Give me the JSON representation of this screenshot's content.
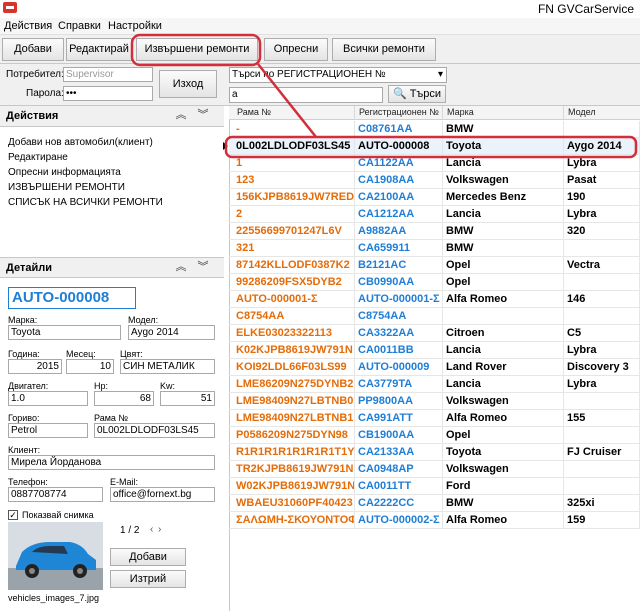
{
  "app": {
    "title": "FN GVCarService"
  },
  "menu": [
    "Действия",
    "Справки",
    "Настройки"
  ],
  "toolbar": {
    "add": "Добави",
    "edit": "Редактирай",
    "done_repairs": "Извършени ремонти",
    "ops": "Опресни",
    "all_repairs": "Всички ремонти"
  },
  "login": {
    "user_label": "Потребител:",
    "user_placeholder": "Supervisor",
    "pass_label": "Парола:",
    "pass_value": "•••",
    "login_button": "Изход"
  },
  "search": {
    "mode": "Търси по РЕГИСТРАЦИОНЕН №",
    "query": "a",
    "button": "Търси"
  },
  "actions": {
    "title": "Действия",
    "items": [
      "Добави нов автомобил(клиент)",
      "Редактиране",
      "Опресни информацията",
      "ИЗВЪРШЕНИ РЕМОНТИ",
      "СПИСЪК НА ВСИЧКИ РЕМОНТИ"
    ]
  },
  "details": {
    "title": "Детайли",
    "reg": "AUTO-000008",
    "make_label": "Марка:",
    "make": "Toyota",
    "model_label": "Модел:",
    "model": "Aygo 2014",
    "year_label": "Година:",
    "year": "2015",
    "month_label": "Месец:",
    "month": "10",
    "color_label": "Цвят:",
    "color": "СИН МЕТАЛИК",
    "engine_label": "Двигател:",
    "engine": "1.0",
    "hp_label": "Hp:",
    "hp": "68",
    "kw_label": "Kw:",
    "kw": "51",
    "fuel_label": "Гориво:",
    "fuel": "Petrol",
    "vin_label": "Рама №",
    "vin": "0L002LDLODF03LS45",
    "client_label": "Клиент:",
    "client": "Мирела Йорданова",
    "phone_label": "Телефон:",
    "phone": "0887708774",
    "email_label": "E-Mail:",
    "email": "office@fornext.bg",
    "show_image": "Показвай снимка",
    "image_counter": "1 / 2",
    "add_image": "Добави",
    "delete_image": "Изтрий",
    "image_name": "vehicles_images_7.jpg"
  },
  "grid": {
    "columns": [
      "Рама №",
      "Регистрационен №",
      "Марка",
      "Модел"
    ],
    "rows": [
      [
        "-",
        "C08761AA",
        "BMW",
        ""
      ],
      [
        "0L002LDLODF03LS45",
        "AUTO-000008",
        "Toyota",
        "Aygo 2014"
      ],
      [
        "1",
        "CA1122AA",
        "Lancia",
        "Lybra"
      ],
      [
        "123",
        "CA1908AA",
        "Volkswagen",
        "Pasat"
      ],
      [
        "156KJPB8619JW7RED",
        "CA2100AA",
        "Mercedes Benz",
        "190"
      ],
      [
        "2",
        "CA1212AA",
        "Lancia",
        "Lybra"
      ],
      [
        "22556699701247L6V",
        "A9882AA",
        "BMW",
        "320"
      ],
      [
        "321",
        "CA659911",
        "BMW",
        ""
      ],
      [
        "87142KLLODF0387K2",
        "B2121AC",
        "Opel",
        "Vectra"
      ],
      [
        "99286209FSX5DYB2",
        "CB0990AA",
        "Opel",
        ""
      ],
      [
        "AUTO-000001-Σ",
        "AUTO-000001-Σ",
        "Alfa Romeo",
        "146"
      ],
      [
        "C8754AA",
        "C8754AA",
        "",
        ""
      ],
      [
        "ELKE03023322113",
        "CA3322AA",
        "Citroen",
        "C5"
      ],
      [
        "K02KJPB8619JW791N",
        "CA0011BB",
        "Lancia",
        "Lybra"
      ],
      [
        "KOI92LDL66F03LS99",
        "AUTO-000009",
        "Land Rover",
        "Discovery 3"
      ],
      [
        "LME86209N275DYNB2",
        "CA3779TA",
        "Lancia",
        "Lybra"
      ],
      [
        "LME98409N27LBTNB0",
        "PP9800AA",
        "Volkswagen",
        ""
      ],
      [
        "LME98409N27LBTNB1",
        "CA991ATT",
        "Alfa Romeo",
        "155"
      ],
      [
        "P0586209N275DYN98",
        "CB1900AA",
        "Opel",
        ""
      ],
      [
        "R1R1R1R1R1R1R1T1Y",
        "CA2133AA",
        "Toyota",
        "FJ Cruiser"
      ],
      [
        "TR2KJPB8619JW791N",
        "CA0948AP",
        "Volkswagen",
        ""
      ],
      [
        "W02KJPB8619JW791N",
        "CA0011TT",
        "Ford",
        ""
      ],
      [
        "WBAEU31060PF40423",
        "CA2222CC",
        "BMW",
        "325xi"
      ],
      [
        "ΣΑΛΩΜΗ-ΣΚΟΥΟΝΤΟΦ",
        "AUTO-000002-Σ",
        "Alfa Romeo",
        "159"
      ]
    ]
  },
  "colors": {
    "accent": "#1f7ed6",
    "vin": "#e46c0a",
    "highlight": "#d32f3a"
  }
}
